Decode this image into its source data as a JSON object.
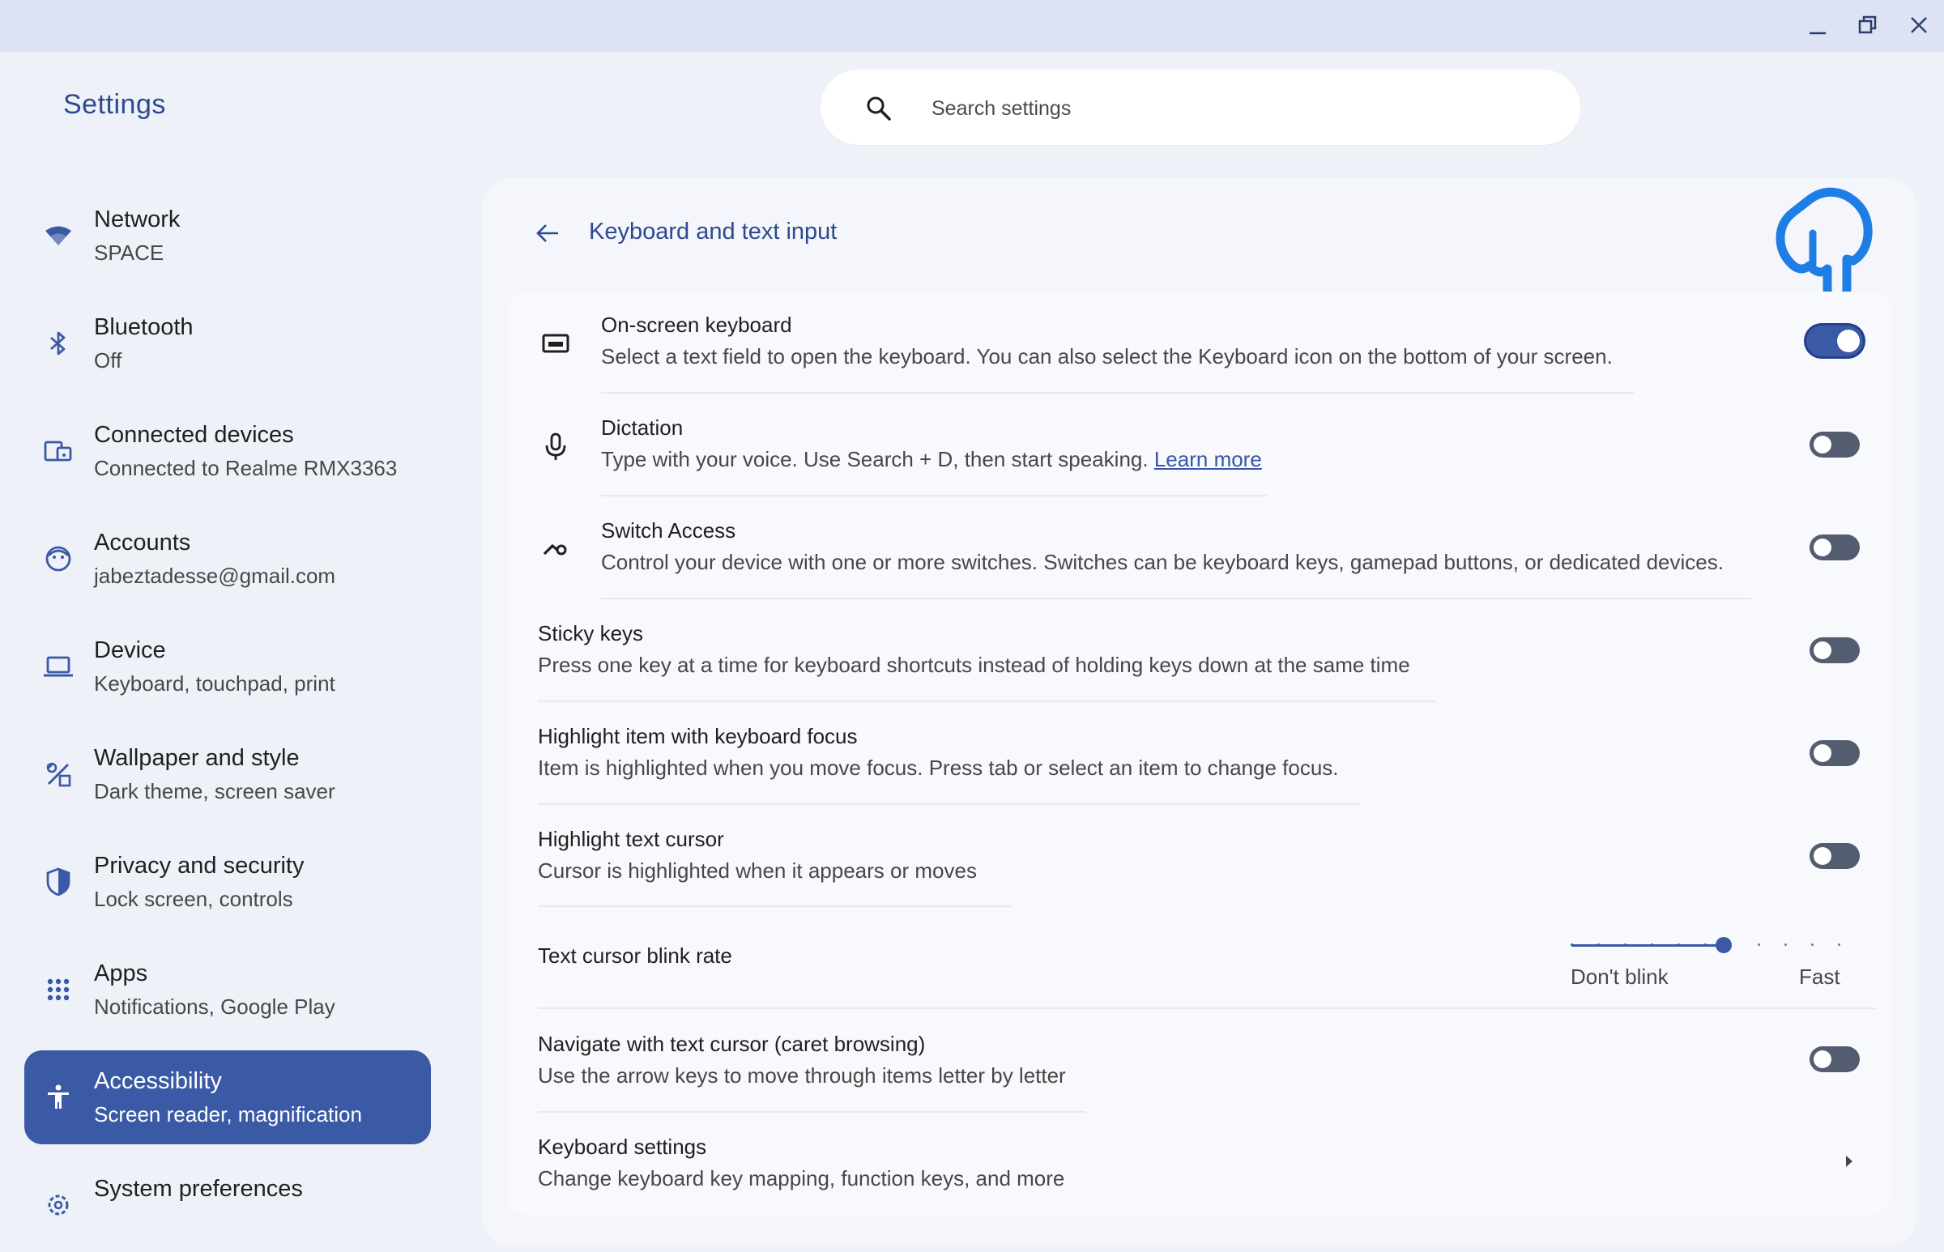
{
  "window": {
    "minimize_icon": "minimize-icon",
    "restore_icon": "restore-icon",
    "close_icon": "close-icon"
  },
  "app_title": "Settings",
  "search": {
    "placeholder": "Search settings",
    "value": ""
  },
  "sidebar": {
    "items": [
      {
        "icon": "wifi-icon",
        "label": "Network",
        "sub": "SPACE",
        "active": false
      },
      {
        "icon": "bluetooth-icon",
        "label": "Bluetooth",
        "sub": "Off",
        "active": false
      },
      {
        "icon": "devices-icon",
        "label": "Connected devices",
        "sub": "Connected to Realme RMX3363",
        "active": false
      },
      {
        "icon": "account-icon",
        "label": "Accounts",
        "sub": "jabeztadesse@gmail.com",
        "active": false
      },
      {
        "icon": "laptop-icon",
        "label": "Device",
        "sub": "Keyboard, touchpad, print",
        "active": false
      },
      {
        "icon": "palette-icon",
        "label": "Wallpaper and style",
        "sub": "Dark theme, screen saver",
        "active": false
      },
      {
        "icon": "shield-icon",
        "label": "Privacy and security",
        "sub": "Lock screen, controls",
        "active": false
      },
      {
        "icon": "apps-grid-icon",
        "label": "Apps",
        "sub": "Notifications, Google Play",
        "active": false
      },
      {
        "icon": "accessibility-icon",
        "label": "Accessibility",
        "sub": "Screen reader, magnification",
        "active": true
      },
      {
        "icon": "gear-icon",
        "label": "System preferences",
        "sub": "",
        "active": false
      }
    ]
  },
  "page": {
    "title": "Keyboard and text input"
  },
  "settings": {
    "onscreen_keyboard": {
      "title": "On-screen keyboard",
      "desc": "Select a text field to open the keyboard. You can also select the Keyboard icon on the bottom of your screen.",
      "enabled": true
    },
    "dictation": {
      "title": "Dictation",
      "desc": "Type with your voice. Use Search + D, then start speaking.",
      "link": "Learn more",
      "enabled": false
    },
    "switch_access": {
      "title": "Switch Access",
      "desc": "Control your device with one or more switches. Switches can be keyboard keys, gamepad buttons, or dedicated devices.",
      "enabled": false
    },
    "sticky_keys": {
      "title": "Sticky keys",
      "desc": "Press one key at a time for keyboard shortcuts instead of holding keys down at the same time",
      "enabled": false
    },
    "highlight_focus": {
      "title": "Highlight item with keyboard focus",
      "desc": "Item is highlighted when you move focus. Press tab or select an item to change focus.",
      "enabled": false
    },
    "highlight_cursor": {
      "title": "Highlight text cursor",
      "desc": "Cursor is highlighted when it appears or moves",
      "enabled": false
    },
    "blink_rate": {
      "title": "Text cursor blink rate",
      "min_label": "Don't blink",
      "max_label": "Fast",
      "level": 0.57
    },
    "caret_browsing": {
      "title": "Navigate with text cursor (caret browsing)",
      "desc": "Use the arrow keys to move through items letter by letter",
      "enabled": false
    },
    "keyboard_settings": {
      "title": "Keyboard settings",
      "desc": "Change keyboard key mapping, function keys, and more"
    }
  },
  "colors": {
    "accent": "#3b5aa5",
    "toggle_off": "#545d70",
    "title_blue": "#2c4a8f"
  }
}
